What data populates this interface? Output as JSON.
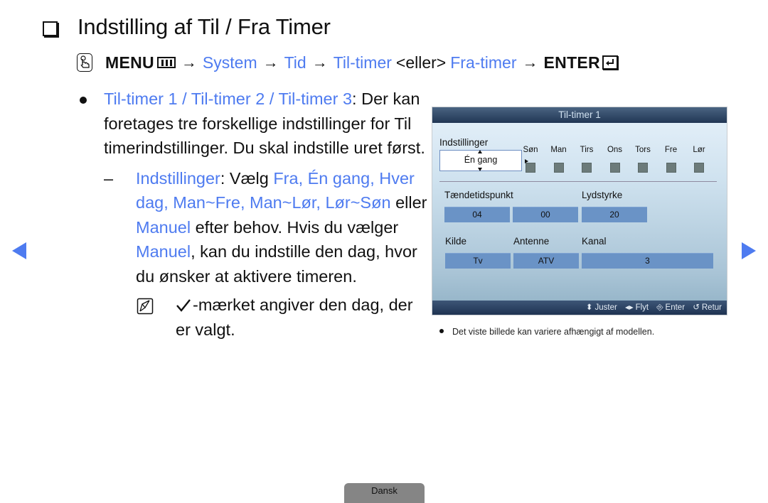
{
  "title": "Indstilling af Til / Fra Timer",
  "menu_path": {
    "menu_label": "MENU",
    "arrow": "→",
    "steps": [
      "System",
      "Tid",
      "Til-timer"
    ],
    "or_label": "<eller>",
    "alt_step": "Fra-timer",
    "enter_label": "ENTER"
  },
  "body": {
    "bullet_heading": "Til-timer 1 / Til-timer 2 / Til-timer",
    "bullet_heading_num": "3",
    "bullet_text": ": Der kan foretages tre forskellige indstillinger for Til timerindstillinger. Du skal indstille uret først.",
    "sub": {
      "dash": "–",
      "term": "Indstillinger",
      "colon_text": ": Vælg ",
      "options_1": "Fra, Én gang, Hver dag, Man~Fre, Man~Lør, Lør~Søn",
      "or_text": " eller ",
      "option_manual": "Manuel",
      "after_text": " efter behov. Hvis du vælger ",
      "option_manual_2": "Manuel",
      "tail_text": ", kan du indstille den dag, hvor du ønsker at aktivere timeren."
    },
    "note_text": "-mærket angiver den dag, der er valgt."
  },
  "tv_panel": {
    "header": "Til-timer 1",
    "settings_label": "Indstillinger",
    "settings_value": "Én gang",
    "days": [
      "Søn",
      "Man",
      "Tirs",
      "Ons",
      "Tors",
      "Fre",
      "Lør"
    ],
    "days_checked": [
      false,
      false,
      false,
      false,
      false,
      false,
      false
    ],
    "on_time_label": "Tændetidspunkt",
    "hour": "04",
    "minute": "00",
    "volume_label": "Lydstyrke",
    "volume": "20",
    "source_label": "Kilde",
    "source": "Tv",
    "antenna_label": "Antenne",
    "antenna": "ATV",
    "channel_label": "Kanal",
    "channel": "3",
    "footer": {
      "adjust": "Juster",
      "move": "Flyt",
      "enter": "Enter",
      "return": "Retur"
    }
  },
  "caption": "Det viste billede kan variere afhængigt af modellen.",
  "language_tab": "Dansk",
  "colors": {
    "accent_blue": "#4e7bf0",
    "tv_header": "#213654",
    "tv_field": "#6a93c6"
  }
}
